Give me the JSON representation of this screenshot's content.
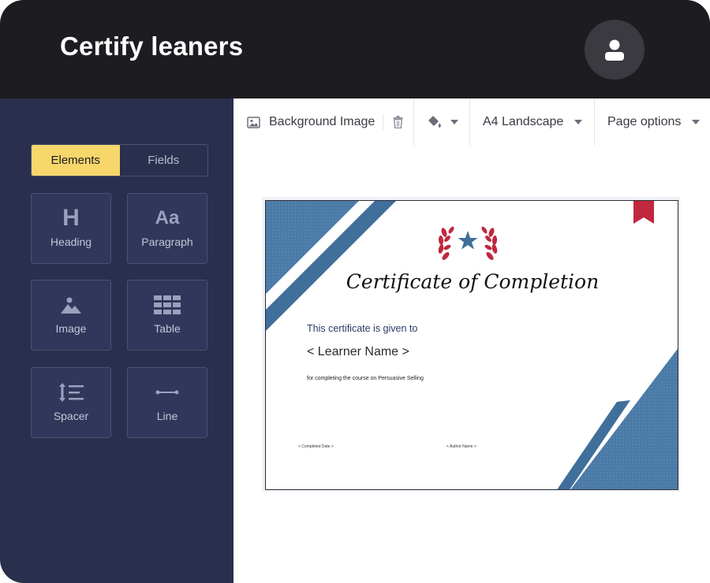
{
  "app": {
    "title": "Certify leaners"
  },
  "header": {
    "avatar_icon": "user-icon"
  },
  "sidebar": {
    "tabs": [
      {
        "label": "Elements",
        "active": true
      },
      {
        "label": "Fields",
        "active": false
      }
    ],
    "elements": [
      {
        "label": "Heading",
        "icon": "heading-icon",
        "glyph": "H"
      },
      {
        "label": "Paragraph",
        "icon": "paragraph-icon",
        "glyph": "Aa"
      },
      {
        "label": "Image",
        "icon": "image-icon"
      },
      {
        "label": "Table",
        "icon": "table-icon"
      },
      {
        "label": "Spacer",
        "icon": "spacer-icon"
      },
      {
        "label": "Line",
        "icon": "line-icon"
      }
    ]
  },
  "toolbar": {
    "background_image_label": "Background Image",
    "page_size": "A4 Landscape",
    "page_options": "Page options"
  },
  "certificate": {
    "title": "Certificate of Completion",
    "given_to": "This certificate is given to",
    "learner_placeholder": "< Learner Name >",
    "course_text": "for completing the course on Persuasive Selling",
    "date_placeholder": "< Completed Date >",
    "author_placeholder": "< Author Name >"
  },
  "colors": {
    "header_bg": "#1d1c21",
    "sidebar_bg": "#2a2f4d",
    "active_tab": "#f7d66b",
    "cert_blue": "#3f6f9a",
    "ribbon_red": "#c0283f"
  }
}
